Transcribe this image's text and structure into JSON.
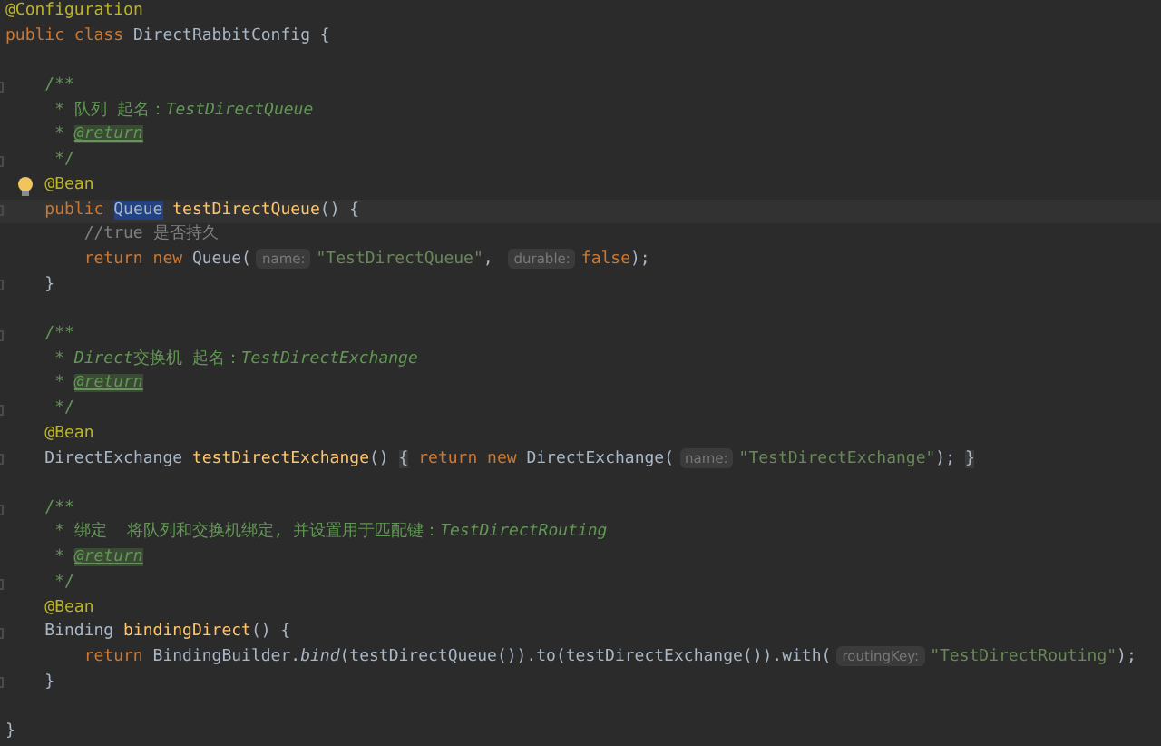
{
  "editor": {
    "lines": [
      {
        "kind": "code",
        "tokens": [
          {
            "t": "@Configuration",
            "kind": "annotation"
          }
        ]
      },
      {
        "kind": "code",
        "tokens": [
          {
            "t": "public class ",
            "kind": "keyword"
          },
          {
            "t": "DirectRabbitConfig {",
            "kind": "plain"
          }
        ]
      },
      {
        "kind": "blank"
      },
      {
        "kind": "code",
        "fold": true,
        "tokens": [
          {
            "t": "    /**",
            "kind": "doc"
          }
        ]
      },
      {
        "kind": "code",
        "tokens": [
          {
            "t": "     * 队列 起名：",
            "kind": "doc"
          },
          {
            "t": "TestDirectQueue",
            "kind": "docitalic"
          }
        ]
      },
      {
        "kind": "code",
        "tokens": [
          {
            "t": "     * ",
            "kind": "doc"
          },
          {
            "t": "@return",
            "kind": "doctag"
          }
        ]
      },
      {
        "kind": "code",
        "fold": true,
        "tokens": [
          {
            "t": "     */",
            "kind": "doc"
          }
        ]
      },
      {
        "kind": "code",
        "bulb": true,
        "tokens": [
          {
            "t": "    @Bean",
            "kind": "annotation"
          }
        ]
      },
      {
        "kind": "code",
        "fold": true,
        "current": true,
        "tokens": [
          {
            "t": "    public ",
            "kind": "keyword"
          },
          {
            "t": "Queue",
            "kind": "selection"
          },
          {
            "t": " testDirectQueue",
            "kind": "method"
          },
          {
            "t": "() {",
            "kind": "plain"
          }
        ]
      },
      {
        "kind": "code",
        "tokens": [
          {
            "t": "        //true 是否持久",
            "kind": "comment"
          }
        ]
      },
      {
        "kind": "code",
        "tokens": [
          {
            "t": "        return new ",
            "kind": "keyword"
          },
          {
            "t": "Queue(",
            "kind": "plain"
          },
          {
            "t": "name:",
            "kind": "hint"
          },
          {
            "t": "\"TestDirectQueue\"",
            "kind": "string"
          },
          {
            "t": ", ",
            "kind": "plain"
          },
          {
            "t": "durable:",
            "kind": "hint"
          },
          {
            "t": "false",
            "kind": "keyword"
          },
          {
            "t": ");",
            "kind": "plain"
          }
        ]
      },
      {
        "kind": "code",
        "fold": true,
        "tokens": [
          {
            "t": "    }",
            "kind": "plain"
          }
        ]
      },
      {
        "kind": "blank"
      },
      {
        "kind": "code",
        "fold": true,
        "tokens": [
          {
            "t": "    /**",
            "kind": "doc"
          }
        ]
      },
      {
        "kind": "code",
        "tokens": [
          {
            "t": "     * ",
            "kind": "doc"
          },
          {
            "t": "Direct",
            "kind": "docitalic"
          },
          {
            "t": "交换机 起名：",
            "kind": "doc"
          },
          {
            "t": "TestDirectExchange",
            "kind": "docitalic"
          }
        ]
      },
      {
        "kind": "code",
        "tokens": [
          {
            "t": "     * ",
            "kind": "doc"
          },
          {
            "t": "@return",
            "kind": "doctag"
          }
        ]
      },
      {
        "kind": "code",
        "fold": true,
        "tokens": [
          {
            "t": "     */",
            "kind": "doc"
          }
        ]
      },
      {
        "kind": "code",
        "tokens": [
          {
            "t": "    @Bean",
            "kind": "annotation"
          }
        ]
      },
      {
        "kind": "code",
        "fold": true,
        "tokens": [
          {
            "t": "    DirectExchange ",
            "kind": "plain"
          },
          {
            "t": "testDirectExchange",
            "kind": "method"
          },
          {
            "t": "() ",
            "kind": "plain"
          },
          {
            "t": "{",
            "kind": "brace"
          },
          {
            "t": " return new ",
            "kind": "keyword"
          },
          {
            "t": "DirectExchange(",
            "kind": "plain"
          },
          {
            "t": "name:",
            "kind": "hint"
          },
          {
            "t": "\"TestDirectExchange\"",
            "kind": "string"
          },
          {
            "t": "); ",
            "kind": "plain"
          },
          {
            "t": "}",
            "kind": "brace"
          }
        ]
      },
      {
        "kind": "blank"
      },
      {
        "kind": "code",
        "fold": true,
        "tokens": [
          {
            "t": "    /**",
            "kind": "doc"
          }
        ]
      },
      {
        "kind": "code",
        "tokens": [
          {
            "t": "     * 绑定  将队列和交换机绑定, 并设置用于匹配键：",
            "kind": "doc"
          },
          {
            "t": "TestDirectRouting",
            "kind": "docitalic"
          }
        ]
      },
      {
        "kind": "code",
        "tokens": [
          {
            "t": "     * ",
            "kind": "doc"
          },
          {
            "t": "@return",
            "kind": "doctag"
          }
        ]
      },
      {
        "kind": "code",
        "fold": true,
        "tokens": [
          {
            "t": "     */",
            "kind": "doc"
          }
        ]
      },
      {
        "kind": "code",
        "tokens": [
          {
            "t": "    @Bean",
            "kind": "annotation"
          }
        ]
      },
      {
        "kind": "code",
        "fold": true,
        "tokens": [
          {
            "t": "    Binding ",
            "kind": "plain"
          },
          {
            "t": "bindingDirect",
            "kind": "method"
          },
          {
            "t": "() {",
            "kind": "plain"
          }
        ]
      },
      {
        "kind": "code",
        "tokens": [
          {
            "t": "        return ",
            "kind": "keyword"
          },
          {
            "t": "BindingBuilder.",
            "kind": "plain"
          },
          {
            "t": "bind",
            "kind": "italic"
          },
          {
            "t": "(testDirectQueue()).to(testDirectExchange()).with(",
            "kind": "plain"
          },
          {
            "t": "routingKey:",
            "kind": "hint"
          },
          {
            "t": "\"TestDirectRouting\"",
            "kind": "string"
          },
          {
            "t": ");",
            "kind": "plain"
          }
        ]
      },
      {
        "kind": "code",
        "fold": true,
        "tokens": [
          {
            "t": "    }",
            "kind": "plain"
          }
        ]
      },
      {
        "kind": "blank"
      },
      {
        "kind": "code",
        "tokens": [
          {
            "t": "}",
            "kind": "plain"
          }
        ]
      }
    ]
  }
}
